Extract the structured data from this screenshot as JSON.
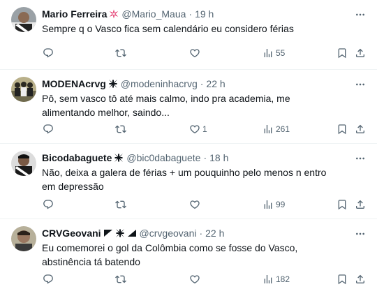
{
  "posts": [
    {
      "name": "Mario Ferreira",
      "badge_icon": "red-star-icon",
      "handle": "@Mario_Maua",
      "separator": "·",
      "time": "19 h",
      "text": "Sempre q o Vasco fica sem calendário eu considero férias",
      "replies": "",
      "reposts": "",
      "likes": "",
      "views": "55"
    },
    {
      "name": "MODENAcrvg",
      "badge_icon": "maltese-cross-icon",
      "handle": "@modeninhacrvg",
      "separator": "·",
      "time": "22 h",
      "text": "Pô, sem vasco tô até mais calmo, indo pra academia, me alimentando melhor, saindo...",
      "replies": "",
      "reposts": "",
      "likes": "1",
      "views": "261"
    },
    {
      "name": "Bicodabaguete",
      "badge_icon": "maltese-cross-icon",
      "handle": "@bic0dabaguete",
      "separator": "·",
      "time": "18 h",
      "text": "Não, deixa a galera de férias + um pouquinho pelo menos n entro em depressão",
      "replies": "",
      "reposts": "",
      "likes": "",
      "views": "99"
    },
    {
      "name": "CRVGeovani",
      "badge_icon": "sash-cross-sash-icons",
      "handle": "@crvgeovani",
      "separator": "·",
      "time": "22 h",
      "text": "Eu comemorei o gol da Colômbia como se fosse do Vasco, abstinência tá batendo",
      "replies": "",
      "reposts": "",
      "likes": "",
      "views": "182"
    }
  ],
  "colors": {
    "text": "#0f1419",
    "secondary": "#536471",
    "divider": "#eff3f4",
    "badge_red": "#e0245e"
  }
}
